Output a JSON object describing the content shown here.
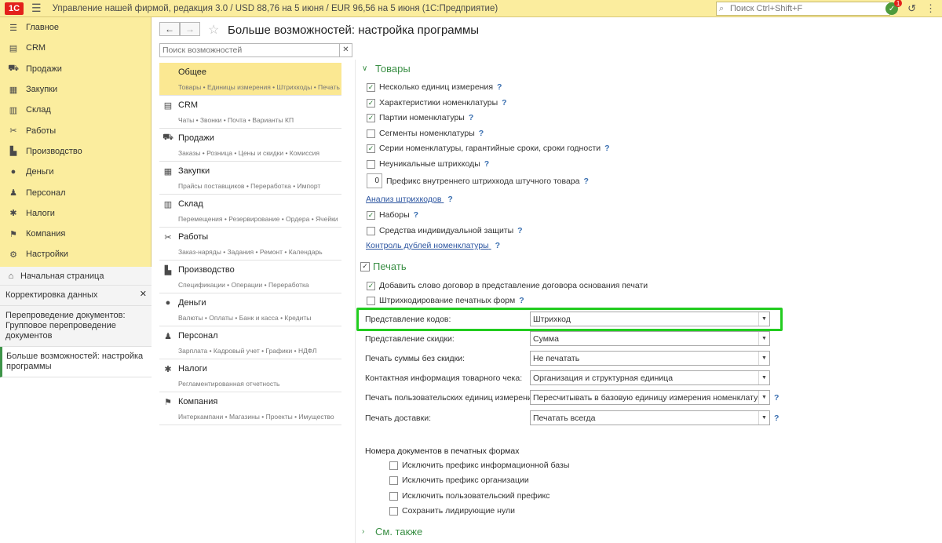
{
  "topbar": {
    "logo": "1С",
    "title": "Управление нашей фирмой, редакция 3.0 / USD 88,76 на 5 июня / EUR 96,56 на 5 июня  (1С:Предприятие)",
    "search_placeholder": "Поиск Ctrl+Shift+F",
    "notifications_count": "1"
  },
  "sidebar": {
    "items": [
      {
        "icon": "menu-lines-icon",
        "label": "Главное"
      },
      {
        "icon": "crm-icon",
        "label": "CRM"
      },
      {
        "icon": "cart-icon",
        "label": "Продажи"
      },
      {
        "icon": "purchase-icon",
        "label": "Закупки"
      },
      {
        "icon": "warehouse-icon",
        "label": "Склад"
      },
      {
        "icon": "tools-icon",
        "label": "Работы"
      },
      {
        "icon": "factory-icon",
        "label": "Производство"
      },
      {
        "icon": "money-icon",
        "label": "Деньги"
      },
      {
        "icon": "person-icon",
        "label": "Персонал"
      },
      {
        "icon": "taxes-icon",
        "label": "Налоги"
      },
      {
        "icon": "flag-icon",
        "label": "Компания"
      },
      {
        "icon": "gear-icon",
        "label": "Настройки"
      }
    ],
    "home": "Начальная страница",
    "open_windows": [
      {
        "label": "Корректировка данных",
        "closable": true
      },
      {
        "label": "Перепроведение документов: Групповое перепроведение документов",
        "closable": false
      },
      {
        "label": "Больше возможностей: настройка программы",
        "closable": false,
        "active": true
      }
    ]
  },
  "header": {
    "title": "Больше возможностей: настройка программы",
    "section_search_placeholder": "Поиск возможностей"
  },
  "sections": [
    {
      "icon": "",
      "title": "Общее",
      "sub": "Товары • Единицы измерения • Штрихкоды • Печать",
      "active": true
    },
    {
      "icon": "crm-icon",
      "title": "CRM",
      "sub": "Чаты • Звонки • Почта • Варианты КП"
    },
    {
      "icon": "cart-icon",
      "title": "Продажи",
      "sub": "Заказы • Розница • Цены и скидки • Комиссия"
    },
    {
      "icon": "purchase-icon",
      "title": "Закупки",
      "sub": "Прайсы поставщиков • Переработка • Импорт"
    },
    {
      "icon": "warehouse-icon",
      "title": "Склад",
      "sub": "Перемещения • Резервирование • Ордера • Ячейки"
    },
    {
      "icon": "tools-icon",
      "title": "Работы",
      "sub": "Заказ-наряды • Задания • Ремонт • Календарь"
    },
    {
      "icon": "factory-icon",
      "title": "Производство",
      "sub": "Спецификации • Операции • Переработка"
    },
    {
      "icon": "money-icon",
      "title": "Деньги",
      "sub": "Валюты • Оплаты • Банк и касса • Кредиты"
    },
    {
      "icon": "person-icon",
      "title": "Персонал",
      "sub": "Зарплата • Кадровый учет • Графики • НДФЛ"
    },
    {
      "icon": "taxes-icon",
      "title": "Налоги",
      "sub": "Регламентированная отчетность"
    },
    {
      "icon": "flag-icon",
      "title": "Компания",
      "sub": "Интеркампани • Магазины • Проекты • Имущество"
    }
  ],
  "goods": {
    "title": "Товары",
    "checks": [
      {
        "label": "Несколько единиц измерения",
        "checked": true
      },
      {
        "label": "Характеристики номенклатуры",
        "checked": true
      },
      {
        "label": "Партии номенклатуры",
        "checked": true
      },
      {
        "label": "Сегменты номенклатуры",
        "checked": false
      },
      {
        "label": "Серии номенклатуры, гарантийные сроки, сроки годности",
        "checked": true
      },
      {
        "label": "Неуникальные штрихкоды",
        "checked": false
      }
    ],
    "prefix_value": "0",
    "prefix_label": "Префикс внутреннего штрихкода штучного товара",
    "barcode_analysis_link": "Анализ штрихкодов",
    "sets": {
      "label": "Наборы",
      "checked": true
    },
    "ppe": {
      "label": "Средства индивидуальной защиты",
      "checked": false
    },
    "duplicates_link": "Контроль дублей номенклатуры"
  },
  "print": {
    "title": "Печать",
    "checks": [
      {
        "label": "Добавить слово договор в представление договора основания печати",
        "checked": true
      },
      {
        "label": "Штрихкодирование печатных форм",
        "checked": false
      }
    ],
    "fields": [
      {
        "label": "Представление кодов:",
        "value": "Штрихкод"
      },
      {
        "label": "Представление скидки:",
        "value": "Сумма"
      },
      {
        "label": "Печать суммы без скидки:",
        "value": "Не печатать"
      },
      {
        "label": "Контактная информация товарного чека:",
        "value": "Организация и структурная единица"
      },
      {
        "label": "Печать пользовательских единиц измерения:",
        "value": "Пересчитывать в базовую единицу измерения номенклатуры"
      },
      {
        "label": "Печать доставки:",
        "value": "Печатать всегда"
      }
    ],
    "doc_numbers_title": "Номера документов в печатных формах",
    "doc_number_checks": [
      {
        "label": "Исключить префикс информационной базы",
        "checked": false
      },
      {
        "label": "Исключить префикс организации",
        "checked": false
      },
      {
        "label": "Исключить пользовательский префикс",
        "checked": false
      },
      {
        "label": "Сохранить лидирующие нули",
        "checked": false
      }
    ]
  },
  "see_also": {
    "title": "См. также"
  }
}
